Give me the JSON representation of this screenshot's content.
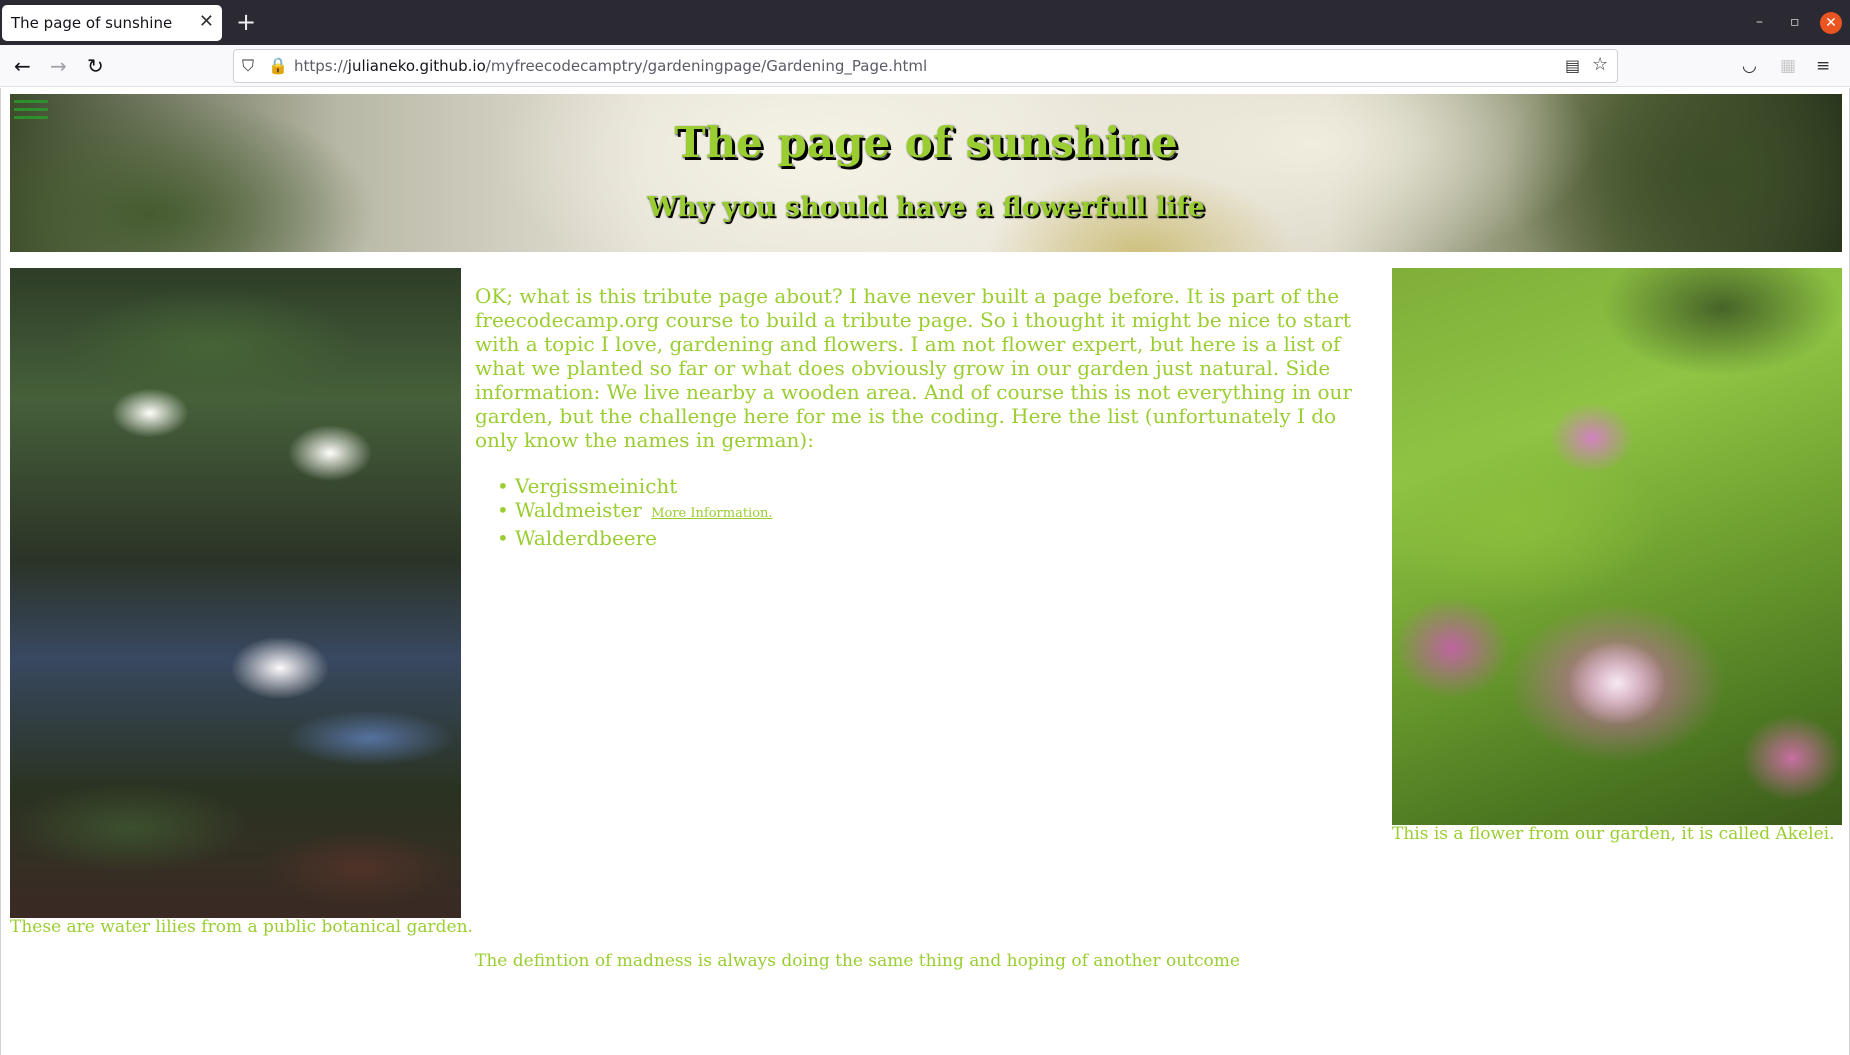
{
  "browser": {
    "tab_title": "The page of sunshine",
    "tab_close": "✕",
    "new_tab": "+",
    "url_prefix": "https://",
    "url_domain": "julianeko.github.io",
    "url_path": "/myfreecodecamptry/gardeningpage/Gardening_Page.html",
    "win_min": "–",
    "win_max": "▫",
    "win_close": "✕"
  },
  "header": {
    "title": "The page of sunshine",
    "subtitle": "Why you should have a flowerfull life"
  },
  "left_image": {
    "caption": "These are water lilies from a public botanical garden."
  },
  "main": {
    "intro": "OK; what is this tribute page about? I have never built a page before. It is part of the freecodecamp.org course to build a tribute page. So i thought it might be nice to start with a topic I love, gardening and flowers. I am not flower expert, but here is a list of what we planted so far or what does obviously grow in our garden just natural. Side information: We live nearby a wooden area. And of course this is not everything in our garden, but the challenge here for me is the coding. Here the list (unfortunately I do only know the names in german):",
    "plants": [
      "Vergissmeinicht",
      "Waldmeister",
      "Walderdbeere"
    ],
    "more_info_link": "More Information.",
    "quote": "The defintion of madness is always doing the same thing and hoping of another outcome"
  },
  "right_image": {
    "caption": "This is a flower from our garden, it is called Akelei."
  },
  "colors": {
    "text_accent": "#9acd32",
    "tabbar": "#2b2a33",
    "close_button": "#e95420"
  }
}
